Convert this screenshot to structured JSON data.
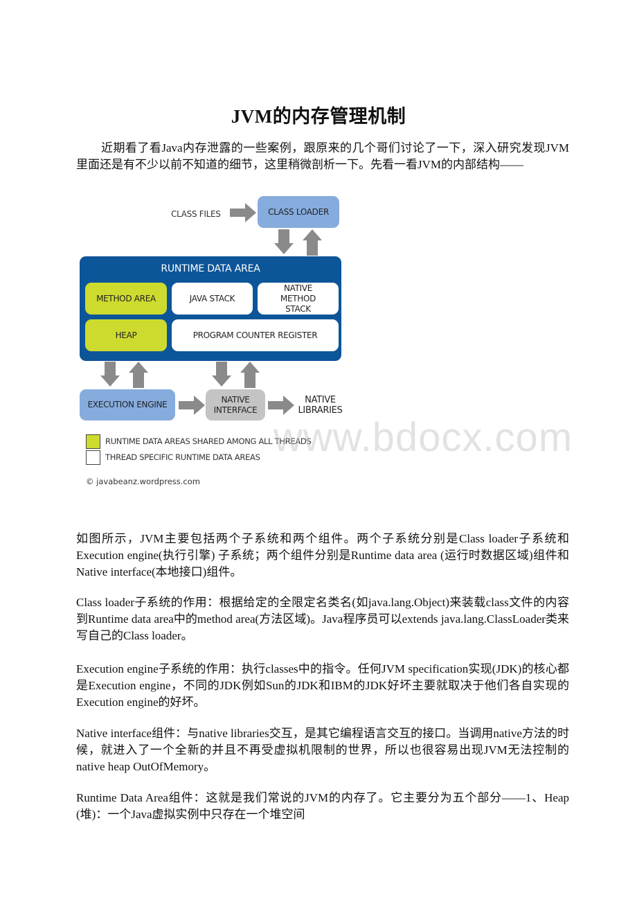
{
  "document": {
    "title": "JVM的内存管理机制",
    "intro": "近期看了看Java内存泄露的一些案例，跟原来的几个哥们讨论了一下，深入研究发现JVM里面还是有不少以前不知道的细节，这里稍微剖析一下。先看一看JVM的内部结构——",
    "paragraphs": [
      "如图所示，JVM主要包括两个子系统和两个组件。两个子系统分别是Class loader子系统和Execution engine(执行引擎) 子系统；两个组件分别是Runtime data area (运行时数据区域)组件和Native interface(本地接口)组件。",
      "Class loader子系统的作用：根据给定的全限定名类名(如java.lang.Object)来装载class文件的内容到Runtime data area中的method area(方法区域)。Java程序员可以extends java.lang.ClassLoader类来写自己的Class loader。",
      "Execution engine子系统的作用：执行classes中的指令。任何JVM specification实现(JDK)的核心都是Execution engine，不同的JDK例如Sun的JDK和IBM的JDK好坏主要就取决于他们各自实现的Execution engine的好坏。",
      "Native interface组件：与native libraries交互，是其它编程语言交互的接口。当调用native方法的时候，就进入了一个全新的并且不再受虚拟机限制的世界，所以也很容易出现JVM无法控制的native heap OutOfMemory。",
      "Runtime Data Area组件：这就是我们常说的JVM的内存了。它主要分为五个部分——1、Heap (堆)：一个Java虚拟实例中只存在一个堆空间"
    ]
  },
  "diagram": {
    "class_files": "CLASS FILES",
    "class_loader": "CLASS LOADER",
    "runtime_data_area": "RUNTIME DATA AREA",
    "method_area": "METHOD AREA",
    "java_stack": "JAVA STACK",
    "native_method_stack": "NATIVE METHOD STACK",
    "heap": "HEAP",
    "program_counter_register": "PROGRAM COUNTER REGISTER",
    "execution_engine": "EXECUTION ENGINE",
    "native_interface": "NATIVE INTERFACE",
    "native_libraries": "NATIVE LIBRARIES",
    "legend": [
      {
        "label": "RUNTIME DATA AREAS SHARED AMONG ALL THREADS",
        "color": "#cddb2f"
      },
      {
        "label": "THREAD SPECIFIC RUNTIME DATA AREAS",
        "color": "#ffffff"
      }
    ],
    "credit": "© javabeanz.wordpress.com",
    "colors": {
      "blue_box": "#86acde",
      "runtime_bg": "#0d5599",
      "shared": "#cddb2f",
      "native_iface": "#c4c4c4",
      "arrow": "#8a8a8a"
    }
  },
  "watermark": "www.bdocx.com"
}
